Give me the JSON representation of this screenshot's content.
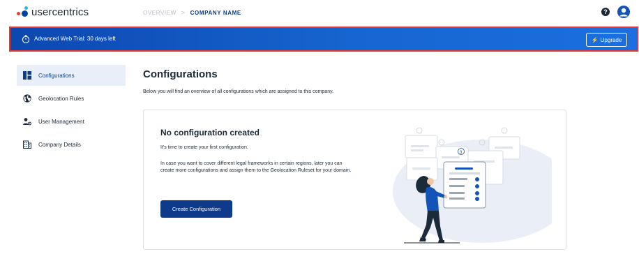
{
  "header": {
    "logo_text": "usercentrics",
    "breadcrumb": {
      "overview": "OVERVIEW",
      "separator": ">",
      "company": "COMPANY NAME"
    },
    "help_icon_glyph": "?"
  },
  "banner": {
    "text": "Advanced Web Trial: 30 days left",
    "upgrade_label": "Upgrade",
    "upgrade_glyph": "⚡"
  },
  "sidebar": {
    "items": [
      {
        "label": "Configurations",
        "icon": "dashboard-icon",
        "active": true
      },
      {
        "label": "Geolocation Rules",
        "icon": "globe-icon",
        "active": false
      },
      {
        "label": "User Management",
        "icon": "user-settings-icon",
        "active": false
      },
      {
        "label": "Company Details",
        "icon": "building-icon",
        "active": false
      }
    ]
  },
  "main": {
    "title": "Configurations",
    "description": "Below you will find an overview of all configurations which are assigned to this company.",
    "empty_state": {
      "title": "No configuration created",
      "subtitle": "It's time to create your first configuration.",
      "body": "In case you want to cover different legal frameworks in certain regions, later you can create more configurations and assign them to the Geolocation Ruleset for your domain.",
      "button_label": "Create Configuration"
    }
  },
  "colors": {
    "brand_dark": "#0d3a8a",
    "banner_blue": "#1765d0",
    "highlight_border": "#e8362c",
    "sidebar_active_bg": "#e8eff8"
  }
}
